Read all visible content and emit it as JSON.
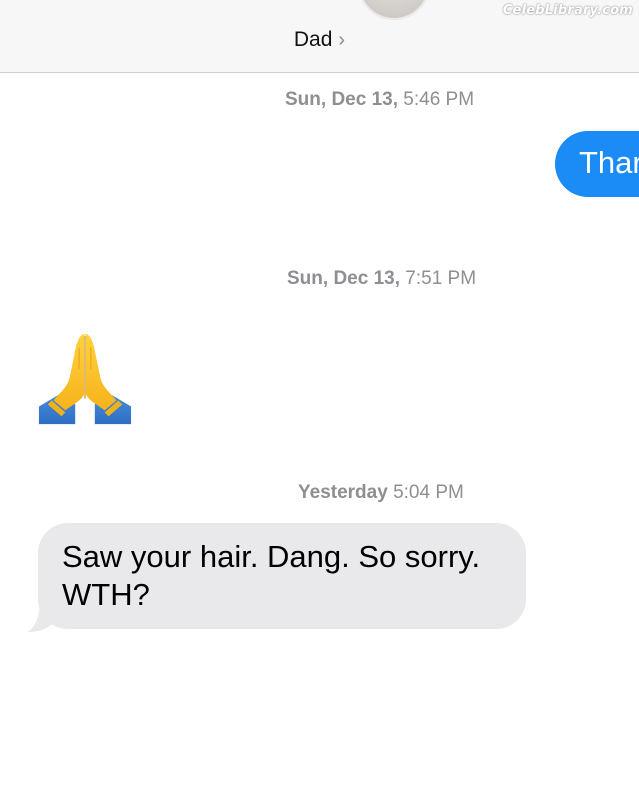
{
  "header": {
    "contact_name": "Dad",
    "chevron_icon": "chevron-right-icon",
    "watermark": "CelebLibrary.com"
  },
  "messages": [
    {
      "type": "timestamp",
      "day": "Sun, Dec 13,",
      "time": "5:46 PM"
    },
    {
      "type": "outgoing",
      "text": "Thar"
    },
    {
      "type": "timestamp",
      "day": "Sun, Dec 13,",
      "time": "7:51 PM"
    },
    {
      "type": "incoming-emoji",
      "icon": "praying-hands-emoji-icon"
    },
    {
      "type": "timestamp",
      "day": "Yesterday",
      "time": "5:04 PM"
    },
    {
      "type": "incoming",
      "text": "Saw your hair. Dang. So sorry. WTH?"
    }
  ],
  "colors": {
    "outgoing_bubble": "#1b8cf5",
    "incoming_bubble": "#e9e9eb",
    "timestamp_text": "#8e8e93"
  }
}
